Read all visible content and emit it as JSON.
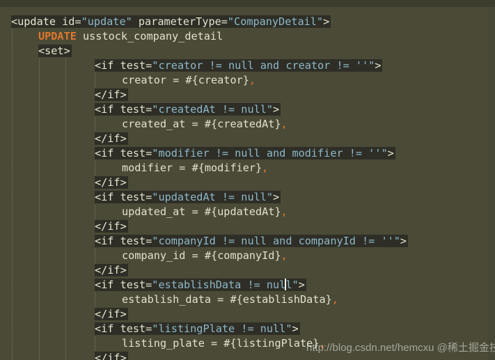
{
  "editor": {
    "lines": [
      {
        "segments": [
          {
            "t": "<update ",
            "c": "tag"
          },
          {
            "t": "id=",
            "c": "attr"
          },
          {
            "t": "\"update\"",
            "c": "str"
          },
          {
            "t": " parameterType=",
            "c": "attr"
          },
          {
            "t": "\"CompanyDetail\"",
            "c": "str"
          },
          {
            "t": ">",
            "c": "tag"
          }
        ]
      },
      {
        "segments": [
          {
            "t": "UPDATE",
            "c": "kw"
          },
          {
            "t": " usstock_company_detail",
            "c": "plain"
          }
        ]
      },
      {
        "segments": [
          {
            "t": "<set>",
            "c": "tag"
          }
        ]
      },
      {
        "segments": [
          {
            "t": "<if ",
            "c": "tag"
          },
          {
            "t": "test=",
            "c": "attr"
          },
          {
            "t": "\"creator != null and creator != ''\"",
            "c": "str"
          },
          {
            "t": ">",
            "c": "tag"
          }
        ]
      },
      {
        "segments": [
          {
            "t": "creator = #{creator}",
            "c": "plain"
          },
          {
            "t": ",",
            "c": "comma"
          }
        ]
      },
      {
        "segments": [
          {
            "t": "</if>",
            "c": "tag"
          }
        ]
      },
      {
        "segments": [
          {
            "t": "<if ",
            "c": "tag"
          },
          {
            "t": "test=",
            "c": "attr"
          },
          {
            "t": "\"createdAt != null\"",
            "c": "str"
          },
          {
            "t": ">",
            "c": "tag"
          }
        ]
      },
      {
        "segments": [
          {
            "t": "created_at = #{createdAt}",
            "c": "plain"
          },
          {
            "t": ",",
            "c": "comma"
          }
        ]
      },
      {
        "segments": [
          {
            "t": "</if>",
            "c": "tag"
          }
        ]
      },
      {
        "segments": [
          {
            "t": "<if ",
            "c": "tag"
          },
          {
            "t": "test=",
            "c": "attr"
          },
          {
            "t": "\"modifier != null and modifier != ''\"",
            "c": "str"
          },
          {
            "t": ">",
            "c": "tag"
          }
        ]
      },
      {
        "segments": [
          {
            "t": "modifier = #{modifier}",
            "c": "plain"
          },
          {
            "t": ",",
            "c": "comma"
          }
        ]
      },
      {
        "segments": [
          {
            "t": "</if>",
            "c": "tag"
          }
        ]
      },
      {
        "segments": [
          {
            "t": "<if ",
            "c": "tag"
          },
          {
            "t": "test=",
            "c": "attr"
          },
          {
            "t": "\"updatedAt != null\"",
            "c": "str"
          },
          {
            "t": ">",
            "c": "tag"
          }
        ]
      },
      {
        "segments": [
          {
            "t": "updated_at = #{updatedAt}",
            "c": "plain"
          },
          {
            "t": ",",
            "c": "comma"
          }
        ]
      },
      {
        "segments": [
          {
            "t": "</if>",
            "c": "tag"
          }
        ]
      },
      {
        "segments": [
          {
            "t": "<if ",
            "c": "tag"
          },
          {
            "t": "test=",
            "c": "attr"
          },
          {
            "t": "\"companyId != null and companyId != ''\"",
            "c": "str"
          },
          {
            "t": ">",
            "c": "tag"
          }
        ]
      },
      {
        "segments": [
          {
            "t": "company_id = #{companyId}",
            "c": "plain"
          },
          {
            "t": ",",
            "c": "comma"
          }
        ]
      },
      {
        "segments": [
          {
            "t": "</if>",
            "c": "tag"
          }
        ]
      },
      {
        "segments": [
          {
            "t": "<if ",
            "c": "tag"
          },
          {
            "t": "test=",
            "c": "attr"
          },
          {
            "t": "\"establishData != null\"",
            "c": "str"
          },
          {
            "t": ">",
            "c": "tag"
          }
        ]
      },
      {
        "segments": [
          {
            "t": "establish_data = #{establishData}",
            "c": "plain"
          },
          {
            "t": ",",
            "c": "comma"
          }
        ]
      },
      {
        "segments": [
          {
            "t": "</if>",
            "c": "tag"
          }
        ]
      },
      {
        "segments": [
          {
            "t": "<if ",
            "c": "tag"
          },
          {
            "t": "test=",
            "c": "attr"
          },
          {
            "t": "\"listingPlate != null\"",
            "c": "str"
          },
          {
            "t": ">",
            "c": "tag"
          }
        ]
      },
      {
        "segments": [
          {
            "t": "listing_plate = #{listingPlate}",
            "c": "plain"
          },
          {
            "t": ",",
            "c": "comma"
          }
        ]
      },
      {
        "segments": [
          {
            "t": "</if>",
            "c": "tag"
          }
        ]
      }
    ]
  },
  "watermark": "http://blog.csdn.net/hemcxu  @稀土掘金技术社区"
}
